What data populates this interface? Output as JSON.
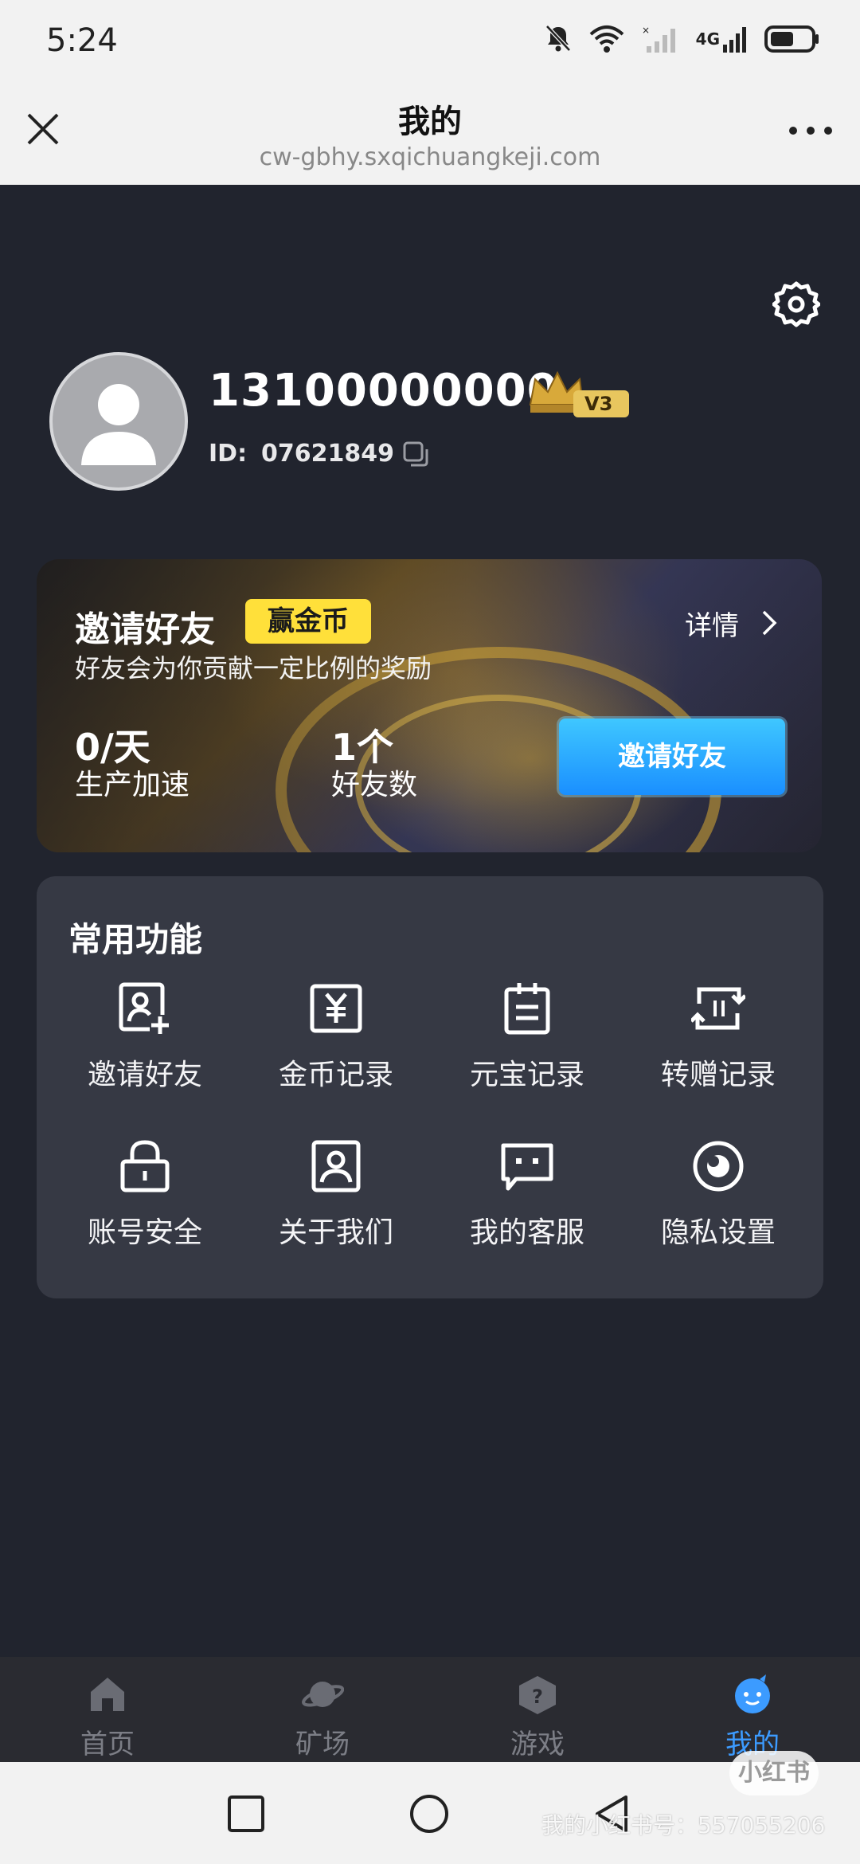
{
  "status_bar": {
    "time": "5:24",
    "network_label": "4G"
  },
  "browser": {
    "title": "我的",
    "url": "cw-gbhy.sxqichuangkeji.com"
  },
  "profile": {
    "phone": "13100000000",
    "vip_level": "V3",
    "id_label": "ID:",
    "id_value": "07621849"
  },
  "invite_banner": {
    "title": "邀请好友",
    "badge": "赢金币",
    "subtitle": "好友会为你贡献一定比例的奖励",
    "details_label": "详情",
    "stat1_value": "0/天",
    "stat1_label": "生产加速",
    "stat2_value": "1个",
    "stat2_label": "好友数",
    "button_label": "邀请好友"
  },
  "functions": {
    "heading": "常用功能",
    "items": [
      {
        "label": "邀请好友",
        "icon": "add-user-icon"
      },
      {
        "label": "金币记录",
        "icon": "yuan-icon"
      },
      {
        "label": "元宝记录",
        "icon": "calendar-icon"
      },
      {
        "label": "转赠记录",
        "icon": "transfer-icon"
      },
      {
        "label": "账号安全",
        "icon": "lock-icon"
      },
      {
        "label": "关于我们",
        "icon": "profile-card-icon"
      },
      {
        "label": "我的客服",
        "icon": "chat-icon"
      },
      {
        "label": "隐私设置",
        "icon": "eye-icon"
      }
    ]
  },
  "tabbar": {
    "items": [
      {
        "label": "首页",
        "icon": "home-icon"
      },
      {
        "label": "矿场",
        "icon": "planet-icon"
      },
      {
        "label": "游戏",
        "icon": "game-box-icon"
      },
      {
        "label": "我的",
        "icon": "mascot-icon"
      }
    ],
    "active": "我的",
    "active_color": "#3c9bff"
  },
  "watermark": {
    "logo": "小红书",
    "text": "我的小红书号：557055206"
  }
}
